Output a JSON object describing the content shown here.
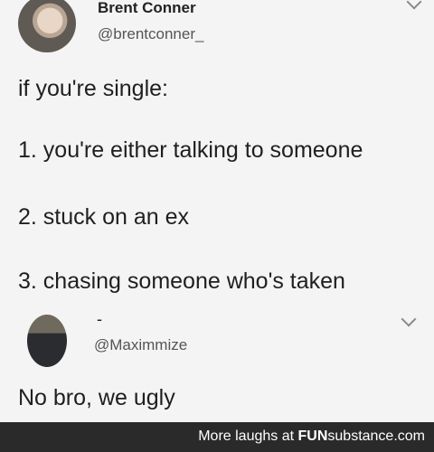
{
  "tweet": {
    "author_name": "Brent Conner",
    "author_handle": "@brentconner_",
    "lines": [
      "if you're single:",
      "1. you're either talking to someone",
      "2. stuck on an ex",
      "3. chasing someone who's taken"
    ]
  },
  "reply": {
    "author_name": "-",
    "author_handle": "@Maximmize",
    "text": "No bro, we ugly"
  },
  "footer": {
    "prefix": "More laughs at ",
    "brand_bold": "FUN",
    "brand_rest": "substance.com"
  },
  "colors": {
    "background": "#f4f4f4",
    "footer_bg": "#2a2a2a"
  }
}
